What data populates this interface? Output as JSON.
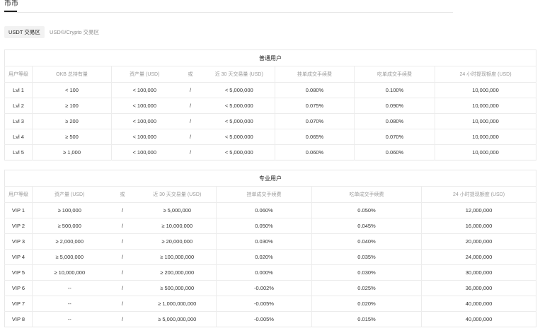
{
  "page": {
    "title": "币币"
  },
  "tabs": [
    {
      "label": "USDT 交易区",
      "selected": true
    },
    {
      "label": "USD©/Crypto 交易区",
      "selected": false
    }
  ],
  "regular": {
    "title": "普通用户",
    "columns": [
      "用户等级",
      "OKB 总持有量",
      "资产量 (USD)",
      "或",
      "近 30 天交易量 (USD)",
      "挂单成交手续费",
      "吃单成交手续费",
      "24 小时提现额度 (USD)"
    ],
    "rows": [
      [
        "Lvl 1",
        "< 100",
        "< 100,000",
        "/",
        "< 5,000,000",
        "0.080%",
        "0.100%",
        "10,000,000"
      ],
      [
        "Lvl 2",
        "≥ 100",
        "< 100,000",
        "/",
        "< 5,000,000",
        "0.075%",
        "0.090%",
        "10,000,000"
      ],
      [
        "Lvl 3",
        "≥ 200",
        "< 100,000",
        "/",
        "< 5,000,000",
        "0.070%",
        "0.080%",
        "10,000,000"
      ],
      [
        "Lvl 4",
        "≥ 500",
        "< 100,000",
        "/",
        "< 5,000,000",
        "0.065%",
        "0.070%",
        "10,000,000"
      ],
      [
        "Lvl 5",
        "≥ 1,000",
        "< 100,000",
        "/",
        "< 5,000,000",
        "0.060%",
        "0.060%",
        "10,000,000"
      ]
    ]
  },
  "pro": {
    "title": "专业用户",
    "columns": [
      "用户等级",
      "资产量 (USD)",
      "或",
      "近 30 天交易量 (USD)",
      "挂单成交手续费",
      "吃单成交手续费",
      "24 小时提现额度 (USD)"
    ],
    "rows": [
      [
        "VIP 1",
        "≥ 100,000",
        "/",
        "≥ 5,000,000",
        "0.060%",
        "0.050%",
        "12,000,000"
      ],
      [
        "VIP 2",
        "≥ 500,000",
        "/",
        "≥ 10,000,000",
        "0.050%",
        "0.045%",
        "16,000,000"
      ],
      [
        "VIP 3",
        "≥ 2,000,000",
        "/",
        "≥ 20,000,000",
        "0.030%",
        "0.040%",
        "20,000,000"
      ],
      [
        "VIP 4",
        "≥ 5,000,000",
        "/",
        "≥ 100,000,000",
        "0.020%",
        "0.035%",
        "24,000,000"
      ],
      [
        "VIP 5",
        "≥ 10,000,000",
        "/",
        "≥ 200,000,000",
        "0.000%",
        "0.030%",
        "30,000,000"
      ],
      [
        "VIP 6",
        "--",
        "/",
        "≥ 500,000,000",
        "-0.002%",
        "0.025%",
        "36,000,000"
      ],
      [
        "VIP 7",
        "--",
        "/",
        "≥ 1,000,000,000",
        "-0.005%",
        "0.020%",
        "40,000,000"
      ],
      [
        "VIP 8",
        "--",
        "/",
        "≥ 5,000,000,000",
        "-0.005%",
        "0.015%",
        "40,000,000"
      ]
    ]
  }
}
